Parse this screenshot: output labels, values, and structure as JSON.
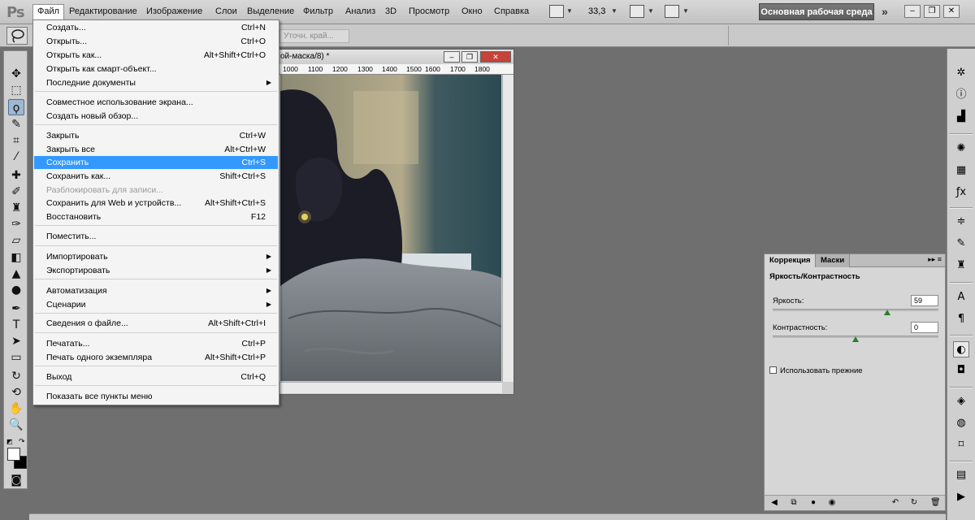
{
  "app": {
    "logo": "Ps"
  },
  "menubar": {
    "items": [
      "Файл",
      "Редактирование",
      "Изображение",
      "Слои",
      "Выделение",
      "Фильтр",
      "Анализ",
      "3D",
      "Просмотр",
      "Окно",
      "Справка"
    ],
    "zoom": "33,3",
    "workspace": "Основная рабочая среда",
    "more": "»"
  },
  "options": {
    "refine_edge": "Уточн. край..."
  },
  "document": {
    "title": "ой-маска/8) *",
    "ruler": [
      "1000",
      "1100",
      "1200",
      "1300",
      "1400",
      "1500",
      "1600",
      "1700",
      "1800"
    ]
  },
  "file_menu": {
    "items": [
      {
        "label": "Создать...",
        "shortcut": "Ctrl+N"
      },
      {
        "label": "Открыть...",
        "shortcut": "Ctrl+O"
      },
      {
        "label": "Открыть как...",
        "shortcut": "Alt+Shift+Ctrl+O"
      },
      {
        "label": "Открыть как смарт-объект...",
        "shortcut": ""
      },
      {
        "label": "Последние документы",
        "shortcut": "",
        "submenu": true
      },
      {
        "label": "Совместное использование экрана...",
        "shortcut": ""
      },
      {
        "label": "Создать новый обзор...",
        "shortcut": ""
      },
      {
        "label": "Закрыть",
        "shortcut": "Ctrl+W"
      },
      {
        "label": "Закрыть все",
        "shortcut": "Alt+Ctrl+W"
      },
      {
        "label": "Сохранить",
        "shortcut": "Ctrl+S",
        "highlighted": true
      },
      {
        "label": "Сохранить как...",
        "shortcut": "Shift+Ctrl+S"
      },
      {
        "label": "Разблокировать для записи...",
        "shortcut": "",
        "disabled": true
      },
      {
        "label": "Сохранить для Web и устройств...",
        "shortcut": "Alt+Shift+Ctrl+S"
      },
      {
        "label": "Восстановить",
        "shortcut": "F12"
      },
      {
        "label": "Поместить...",
        "shortcut": ""
      },
      {
        "label": "Импортировать",
        "shortcut": "",
        "submenu": true
      },
      {
        "label": "Экспортировать",
        "shortcut": "",
        "submenu": true
      },
      {
        "label": "Автоматизация",
        "shortcut": "",
        "submenu": true
      },
      {
        "label": "Сценарии",
        "shortcut": "",
        "submenu": true
      },
      {
        "label": "Сведения о файле...",
        "shortcut": "Alt+Shift+Ctrl+I"
      },
      {
        "label": "Печатать...",
        "shortcut": "Ctrl+P"
      },
      {
        "label": "Печать одного экземпляра",
        "shortcut": "Alt+Shift+Ctrl+P"
      },
      {
        "label": "Выход",
        "shortcut": "Ctrl+Q"
      },
      {
        "label": "Показать все пункты меню",
        "shortcut": ""
      }
    ]
  },
  "correction_panel": {
    "tabs": [
      "Коррекция",
      "Маски"
    ],
    "title": "Яркость/Контрастность",
    "brightness": {
      "label": "Яркость:",
      "value": "59"
    },
    "contrast": {
      "label": "Контрастность:",
      "value": "0"
    },
    "legacy_label": "Использовать прежние"
  },
  "colors": {
    "highlight": "#3399ff",
    "workspace_btn": "#6a6a6a",
    "canvas_bg": "#6f6f6f"
  }
}
